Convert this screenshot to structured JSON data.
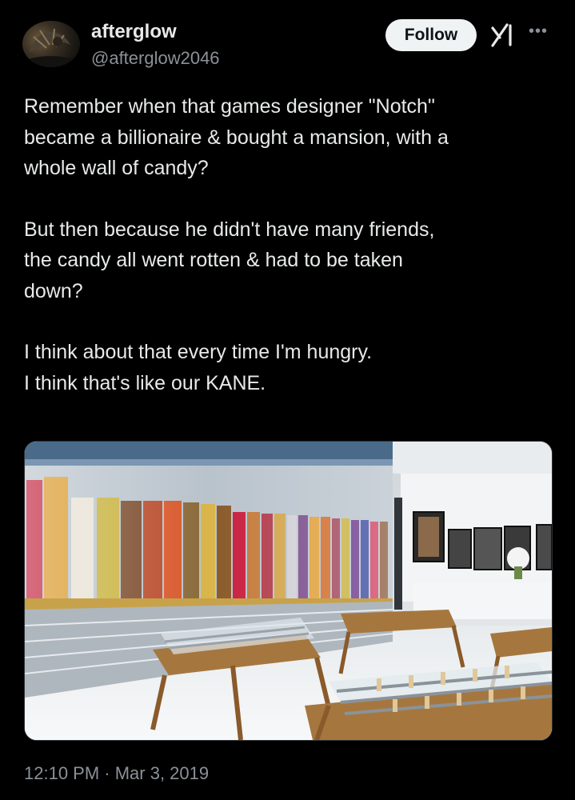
{
  "author": {
    "display_name": "afterglow",
    "handle": "@afterglow2046",
    "follow_label": "Follow"
  },
  "tweet": {
    "paragraphs": [
      "Remember when that games designer \"Notch\"\nbecame a billionaire & bought a mansion, with a\nwhole wall of candy?",
      "But then because he didn't have many friends,\nthe candy all went rotten & had to be taken\ndown?",
      "I think about that every time I'm hungry.\nI think that's like our KANE."
    ]
  },
  "meta": {
    "timestamp": "12:10 PM · Mar 3, 2019"
  },
  "icons": {
    "grok": "grok-icon",
    "more": "more-options-icon"
  },
  "theme": {
    "background": "#000000",
    "text": "#e7e9ea",
    "muted": "#8b9197",
    "follow_bg": "#eff3f4"
  }
}
